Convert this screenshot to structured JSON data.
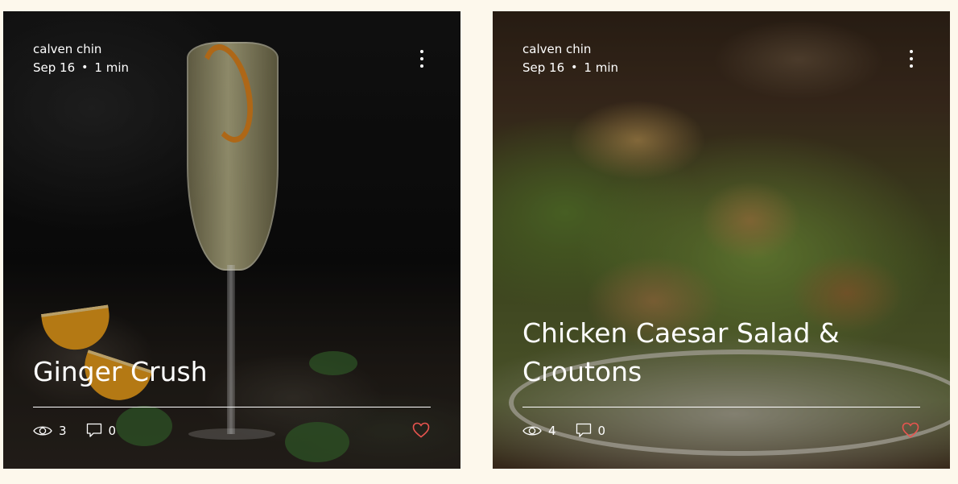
{
  "posts": [
    {
      "author": "calven chin",
      "date": "Sep 16",
      "separator": "•",
      "read_time": "1 min",
      "title": "Ginger Crush",
      "views": "3",
      "comments": "0",
      "like_color": "#e8544f"
    },
    {
      "author": "calven chin",
      "date": "Sep 16",
      "separator": "•",
      "read_time": "1 min",
      "title": "Chicken Caesar Salad & Croutons",
      "views": "4",
      "comments": "0",
      "like_color": "#e8544f"
    }
  ],
  "icons": {
    "more": "more-vertical-icon",
    "views": "eye-icon",
    "comments": "comment-icon",
    "like": "heart-icon"
  },
  "colors": {
    "page_background": "#fdf8ec",
    "text": "#ffffff",
    "like": "#e8544f"
  }
}
